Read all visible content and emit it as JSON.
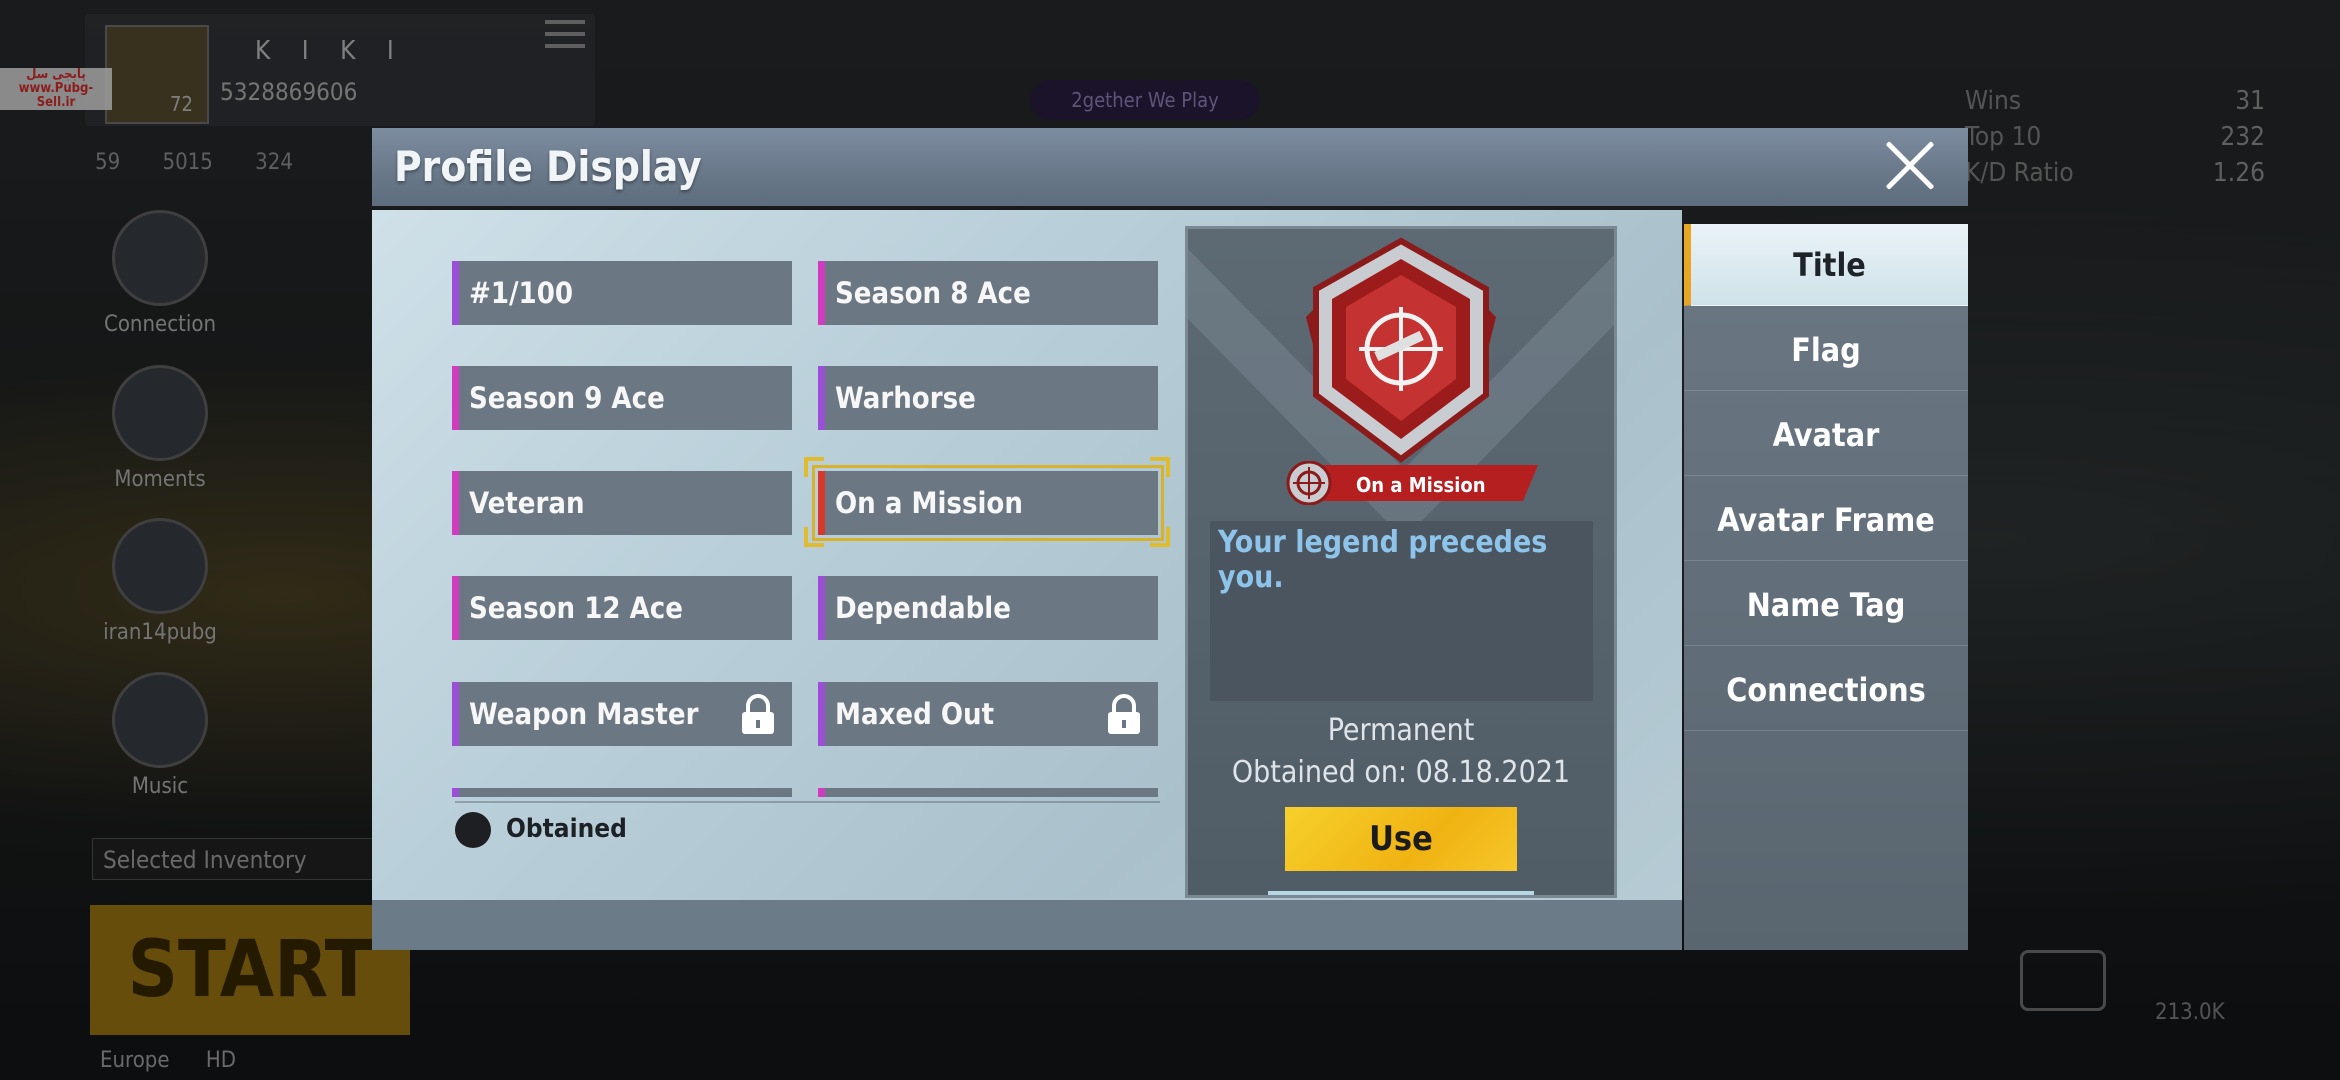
{
  "background": {
    "player_name": "K I K I",
    "player_id": "5328869606",
    "player_level": "72",
    "stats": [
      "59",
      "5015",
      "324"
    ],
    "side_items": [
      "Connection",
      "Moments",
      "iran14pubg",
      "Music"
    ],
    "selected_inventory": "Selected Inventory",
    "start_label": "START",
    "region": "Europe",
    "quality": "HD",
    "together_label": "2gether We Play",
    "right_stats": [
      {
        "label": "Wins",
        "value": "31"
      },
      {
        "label": "Top 10",
        "value": "232"
      },
      {
        "label": "K/D Ratio",
        "value": "1.26"
      }
    ],
    "count_label": "213.0K",
    "watermark": [
      "پابجی سل",
      "www.Pubg-Sell.ir"
    ]
  },
  "dialog": {
    "title": "Profile Display",
    "close_icon": "close-icon",
    "titles": [
      {
        "label": "#1/100",
        "color": "purple",
        "locked": false
      },
      {
        "label": "Season 8 Ace",
        "color": "magenta",
        "locked": false
      },
      {
        "label": "Season 9 Ace",
        "color": "magenta",
        "locked": false
      },
      {
        "label": "Warhorse",
        "color": "purple",
        "locked": false
      },
      {
        "label": "Veteran",
        "color": "magenta",
        "locked": false
      },
      {
        "label": "On a Mission",
        "color": "red",
        "locked": false,
        "selected": true
      },
      {
        "label": "Season 12 Ace",
        "color": "magenta",
        "locked": false
      },
      {
        "label": "Dependable",
        "color": "purple",
        "locked": false
      },
      {
        "label": "Weapon Master",
        "color": "purple",
        "locked": true
      },
      {
        "label": "Maxed Out",
        "color": "purple",
        "locked": true
      }
    ],
    "legend_label": "Obtained",
    "detail": {
      "badge_name": "On a Mission",
      "description": "Your legend precedes you.",
      "duration": "Permanent",
      "obtained_on": "Obtained on: 08.18.2021",
      "use_label": "Use"
    },
    "tabs": [
      "Title",
      "Flag",
      "Avatar",
      "Avatar Frame",
      "Name Tag",
      "Connections"
    ],
    "active_tab": "Title",
    "colors": {
      "accent": "#e8a624",
      "use_button": "#f2bd1a",
      "selected_outline": "#d8b22a"
    }
  }
}
